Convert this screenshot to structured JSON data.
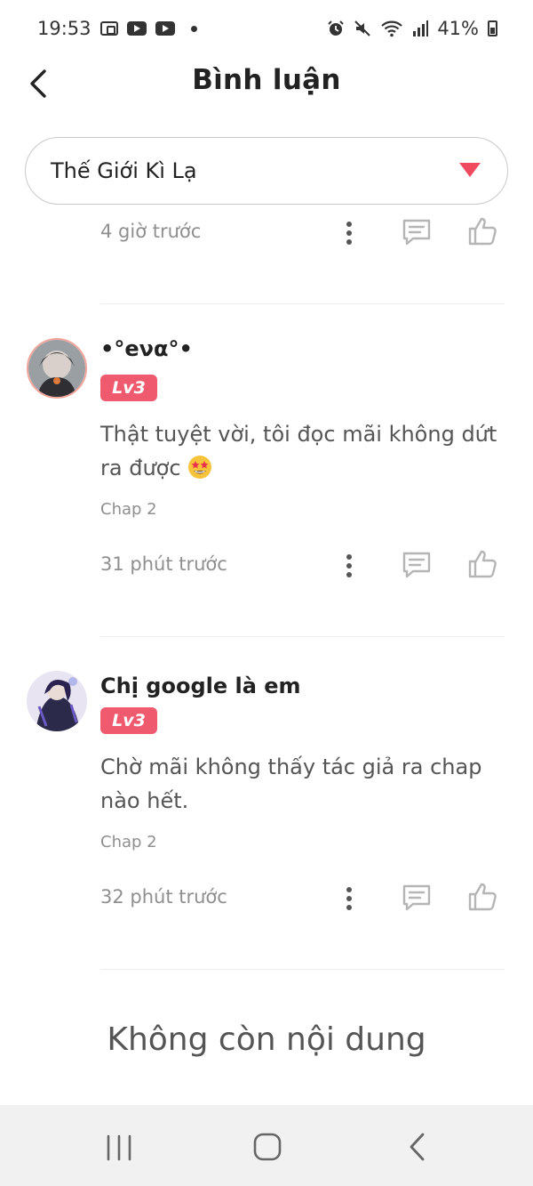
{
  "status_bar": {
    "time": "19:53",
    "battery": "41%",
    "icons": [
      "screen-record-icon",
      "youtube-icon",
      "youtube-icon",
      "dot-icon",
      "alarm-icon",
      "mute-icon",
      "wifi-icon",
      "signal-icon",
      "battery-icon"
    ]
  },
  "header": {
    "title": "Bình luận",
    "back_icon": "chevron-left-icon"
  },
  "selector": {
    "value": "Thế Giới Kì Lạ",
    "icon": "triangle-down-icon",
    "icon_color": "#f04a5e"
  },
  "top_partial": {
    "time": "4 giờ trước"
  },
  "comments": [
    {
      "username": "•°eνα°•",
      "level": "Lv3",
      "text": "Thật tuyệt vời, tôi đọc mãi không dứt ra được",
      "emoji": "star-struck-emoji",
      "chapter": "Chap 2",
      "time": "31 phút trước"
    },
    {
      "username": "Chị google là em",
      "level": "Lv3",
      "text": "Chờ mãi không thấy tác giả ra chap nào hết.",
      "chapter": "Chap 2",
      "time": "32 phút trước"
    }
  ],
  "end_message": "Không còn nội dung",
  "colors": {
    "accent": "#f05a6e",
    "muted_text": "#8f8f8f",
    "icon_gray": "#b5b5b5"
  },
  "nav_bar": {
    "icons": [
      "recent-apps-icon",
      "home-icon",
      "back-icon"
    ]
  }
}
